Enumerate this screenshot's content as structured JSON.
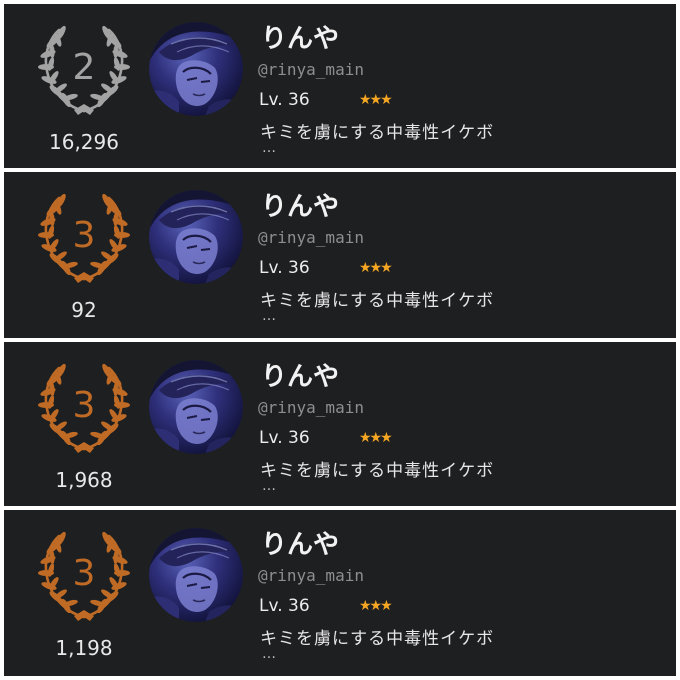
{
  "entries": [
    {
      "rank": "2",
      "score": "16,296",
      "name": "りんや",
      "handle": "@rinya_main",
      "level": "Lv. 36",
      "stars": "★★★",
      "bio": "キミを虜にする中毒性イケボ",
      "more": "…",
      "wreath_color": "#a3a3a3"
    },
    {
      "rank": "3",
      "score": "92",
      "name": "りんや",
      "handle": "@rinya_main",
      "level": "Lv. 36",
      "stars": "★★★",
      "bio": "キミを虜にする中毒性イケボ",
      "more": "…",
      "wreath_color": "#c06b25"
    },
    {
      "rank": "3",
      "score": "1,968",
      "name": "りんや",
      "handle": "@rinya_main",
      "level": "Lv. 36",
      "stars": "★★★",
      "bio": "キミを虜にする中毒性イケボ",
      "more": "…",
      "wreath_color": "#c06b25"
    },
    {
      "rank": "3",
      "score": "1,198",
      "name": "りんや",
      "handle": "@rinya_main",
      "level": "Lv. 36",
      "stars": "★★★",
      "bio": "キミを虜にする中毒性イケボ",
      "more": "…",
      "wreath_color": "#c06b25"
    }
  ],
  "colors": {
    "card_background": "#1e1f21",
    "star": "#f5a623",
    "silver": "#a3a3a3",
    "bronze": "#c06b25"
  }
}
